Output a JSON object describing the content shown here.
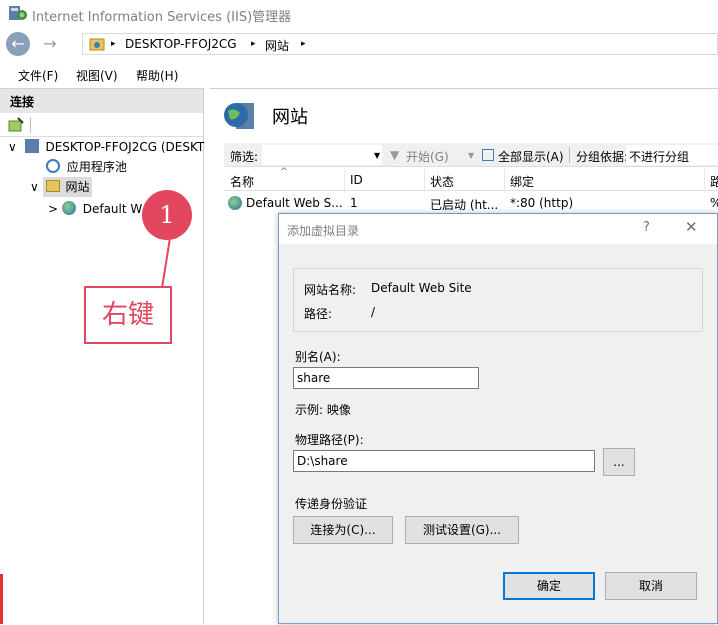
{
  "window": {
    "title": "Internet Information Services (IIS)管理器"
  },
  "address": {
    "segments": [
      "DESKTOP-FFOJ2CG",
      "网站"
    ],
    "separator": "▸"
  },
  "menu": [
    "文件(F)",
    "视图(V)",
    "帮助(H)"
  ],
  "connections": {
    "header": "连接",
    "tree": [
      {
        "label": "DESKTOP-FFOJ2CG (DESKT",
        "expander": "∨"
      },
      {
        "label": "应用程序池"
      },
      {
        "label": "网站",
        "expander": "∨"
      },
      {
        "label": "Default W",
        "expander": ">"
      }
    ]
  },
  "sites": {
    "title": "网站",
    "filter": {
      "label": "筛选:",
      "start": "开始(G)",
      "show_all": "全部显示(A)",
      "group_by_label": "分组依据:",
      "group_by_value": "不进行分组"
    },
    "columns": [
      "名称",
      "ID",
      "状态",
      "绑定",
      "路"
    ],
    "rows": [
      {
        "name": "Default Web S...",
        "id": "1",
        "status": "已启动 (ht...",
        "binding": "*:80 (http)",
        "extra": "%"
      }
    ]
  },
  "dialog": {
    "title": "添加虚拟目录",
    "help": "?",
    "close": "✕",
    "site_name_label": "网站名称:",
    "site_name_value": "Default Web Site",
    "path_label": "路径:",
    "path_value": "/",
    "alias_label": "别名(A):",
    "alias_value": "share",
    "example": "示例: 映像",
    "physical_path_label": "物理路径(P):",
    "physical_path_value": "D:\\share",
    "browse": "...",
    "auth_label": "传递身份验证",
    "connect_as": "连接为(C)...",
    "test_settings": "测试设置(G)...",
    "ok": "确定",
    "cancel": "取消"
  },
  "annotation": {
    "number": "1",
    "text": "右键"
  },
  "colors": {
    "accent": "#0078d7",
    "annotation": "#e2475f"
  }
}
